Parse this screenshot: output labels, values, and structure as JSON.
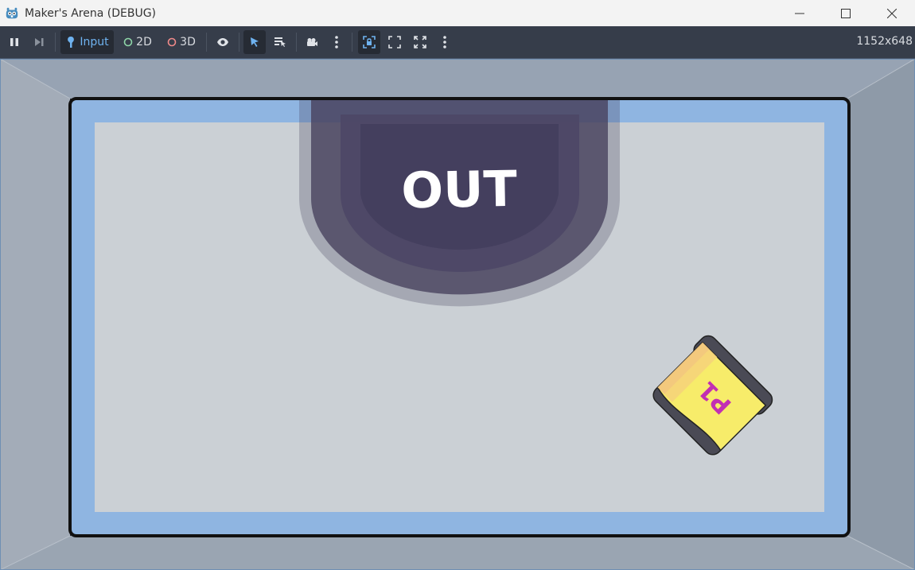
{
  "window": {
    "title": "Maker's Arena (DEBUG)",
    "app_icon": "godot-logo-icon",
    "controls": [
      "minimize-icon",
      "maximize-icon",
      "close-icon"
    ]
  },
  "toolbar": {
    "pause_icon": "pause-icon",
    "next_frame_icon": "next-frame-icon",
    "input_label": "Input",
    "mode_2d_label": "2D",
    "mode_3d_label": "3D",
    "visibility_icon": "eye-icon",
    "select_icon": "cursor-icon",
    "list_select_icon": "list-select-icon",
    "camera_icon": "camera-icon",
    "menu_icon": "more-vertical-icon",
    "camera_override_icon": "camera-override-icon",
    "fullscreen_icon": "fullscreen-icon",
    "resolution": "1152x648",
    "colors": {
      "bar": "#363d4a",
      "accent": "#6fb3f0",
      "mode_2d_ring": "#8ed6a8",
      "mode_3d_ring": "#f08a8a"
    }
  },
  "game": {
    "out_zone_label": "OUT",
    "player_label": "P1",
    "colors": {
      "wall": "#9aa7b6",
      "arena_border": "#8fb5e1",
      "arena_floor": "#cbd0d5",
      "out_zone": "#46405c",
      "player_body": "#f7ec6a",
      "player_label": "#c22fb3",
      "player_treads": "#4a4a55"
    }
  }
}
